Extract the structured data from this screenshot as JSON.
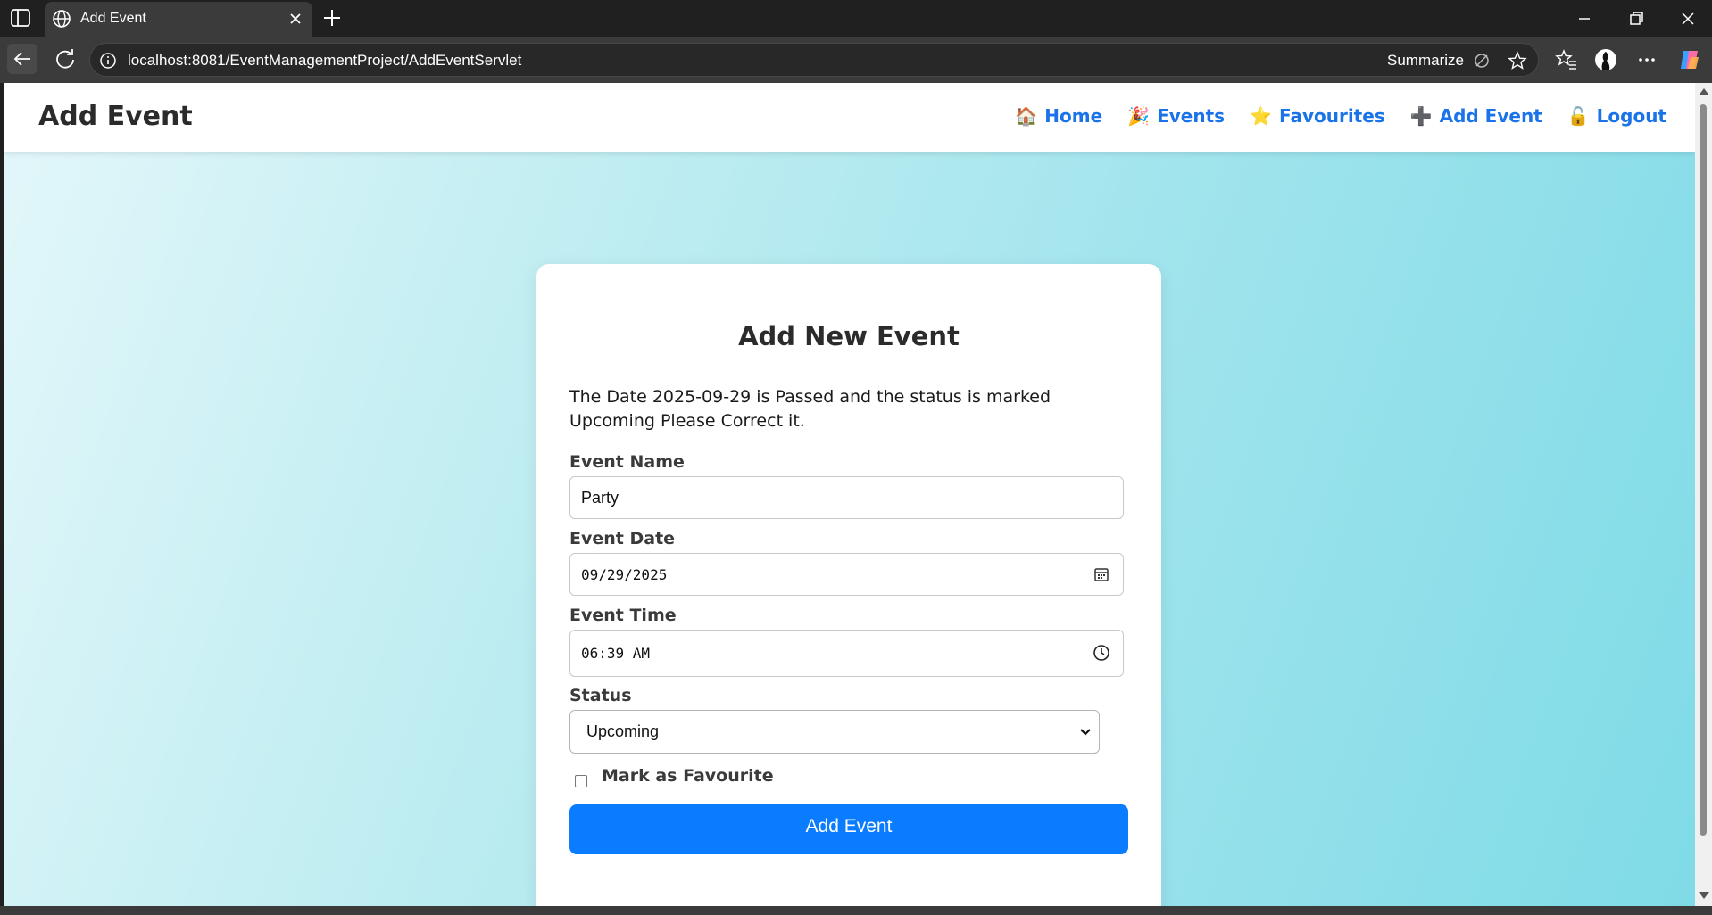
{
  "browser": {
    "tab_title": "Add Event",
    "url": "localhost:8081/EventManagementProject/AddEventServlet",
    "summarize_label": "Summarize"
  },
  "navbar": {
    "brand": "Add Event",
    "links": [
      {
        "emoji": "🏠",
        "label": "Home"
      },
      {
        "emoji": "🎉",
        "label": "Events"
      },
      {
        "emoji": "⭐",
        "label": "Favourites"
      },
      {
        "emoji": "➕",
        "label": "Add Event"
      },
      {
        "emoji": "🔓",
        "label": "Logout"
      }
    ]
  },
  "form": {
    "title": "Add New Event",
    "error_message": "The Date 2025-09-29 is Passed and the status is marked Upcoming Please Correct it.",
    "event_name_label": "Event Name",
    "event_name_value": "Party",
    "event_date_label": "Event Date",
    "event_date_value": "09/29/2025",
    "event_time_label": "Event Time",
    "event_time_value": "06:39 AM",
    "status_label": "Status",
    "status_value": "Upcoming",
    "favourite_label": "Mark as Favourite",
    "favourite_checked": false,
    "submit_label": "Add Event"
  },
  "colors": {
    "link": "#1a73e8",
    "submit": "#0a7cff",
    "gradient_start": "#e3f7fa",
    "gradient_end": "#7fdbe7"
  }
}
